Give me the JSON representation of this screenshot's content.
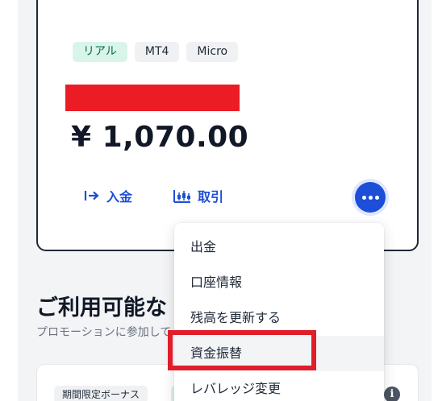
{
  "account": {
    "badges": [
      "リアル",
      "MT4",
      "Micro"
    ],
    "balance": "¥ 1,070.00",
    "actions": {
      "deposit_label": "入金",
      "trade_label": "取引"
    }
  },
  "menu": {
    "items": [
      "出金",
      "口座情報",
      "残高を更新する",
      "資金振替",
      "レバレッジ変更"
    ],
    "highlighted": "資金振替"
  },
  "section": {
    "title": "ご利用可能な",
    "subtitle": "プロモーションに参加して"
  },
  "promo": {
    "badge_label": "期間限定ボーナス",
    "info_glyph": "i"
  },
  "colors": {
    "accent": "#1d4ed8",
    "real_badge_bg": "#d9f5ea",
    "annotation_red": "#e11d2a",
    "redaction_red": "#ec1c24"
  }
}
